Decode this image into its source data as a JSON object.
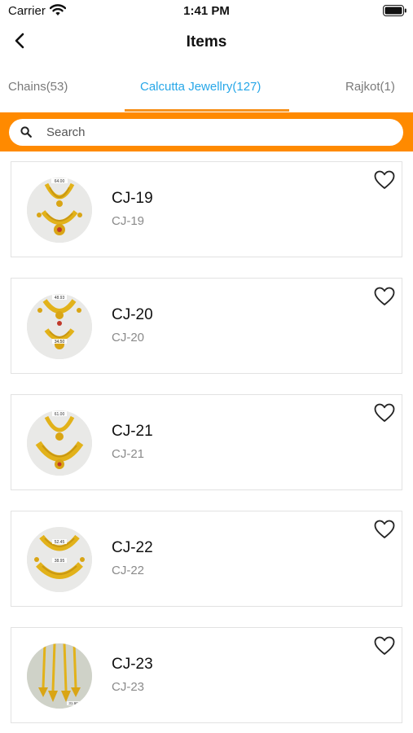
{
  "status_bar": {
    "carrier": "Carrier",
    "time": "1:41 PM"
  },
  "nav": {
    "title": "Items"
  },
  "tabs": [
    {
      "label": "Chains(53)",
      "active": false
    },
    {
      "label": "Calcutta Jewellry(127)",
      "active": true
    },
    {
      "label": "Rajkot(1)",
      "active": false
    }
  ],
  "search": {
    "placeholder": "Search",
    "value": ""
  },
  "items": [
    {
      "title": "CJ-19",
      "subtitle": "CJ-19",
      "thumb_labels": [
        "64.00"
      ]
    },
    {
      "title": "CJ-20",
      "subtitle": "CJ-20",
      "thumb_labels": [
        "48.93",
        "34.50"
      ]
    },
    {
      "title": "CJ-21",
      "subtitle": "CJ-21",
      "thumb_labels": [
        "61.00"
      ]
    },
    {
      "title": "CJ-22",
      "subtitle": "CJ-22",
      "thumb_labels": [
        "52.45",
        "38.95"
      ]
    },
    {
      "title": "CJ-23",
      "subtitle": "CJ-23",
      "thumb_labels": [
        "31.90"
      ]
    }
  ],
  "colors": {
    "accent_orange": "#ff8a00",
    "active_tab": "#27a7e8",
    "tab_indicator": "#f7931e",
    "gold": "#e2b21a"
  },
  "icons": {
    "back": "chevron-left-icon",
    "search": "search-icon",
    "favorite": "heart-outline-icon"
  }
}
